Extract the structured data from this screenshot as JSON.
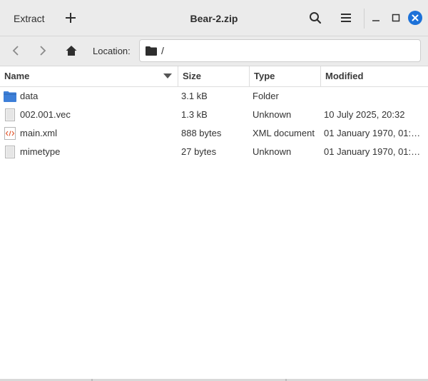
{
  "toolbar": {
    "extract_label": "Extract",
    "title": "Bear-2.zip"
  },
  "location": {
    "label": "Location:",
    "path": "/"
  },
  "columns": {
    "name": "Name",
    "size": "Size",
    "type": "Type",
    "modified": "Modified"
  },
  "files": [
    {
      "name": "data",
      "size": "3.1 kB",
      "type": "Folder",
      "modified": "",
      "icon": "folder-icon"
    },
    {
      "name": "002.001.vec",
      "size": "1.3 kB",
      "type": "Unknown",
      "modified": "10 July 2025, 20:32",
      "icon": "unknown-file-icon"
    },
    {
      "name": "main.xml",
      "size": "888 bytes",
      "type": "XML document",
      "modified": "01 January 1970, 01:…",
      "icon": "xml-file-icon"
    },
    {
      "name": "mimetype",
      "size": "27 bytes",
      "type": "Unknown",
      "modified": "01 January 1970, 01:…",
      "icon": "unknown-file-icon"
    }
  ],
  "colors": {
    "folder": "#3d7fd8",
    "close_button": "#1c71d8",
    "xml_accent": "#e0552b"
  }
}
